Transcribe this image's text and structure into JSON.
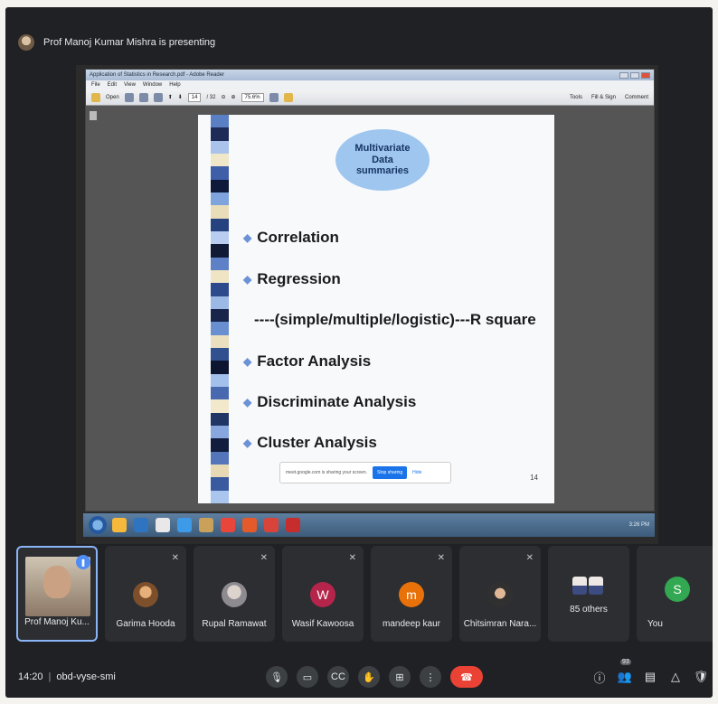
{
  "presenter_bar": {
    "text": "Prof Manoj Kumar Mishra is presenting"
  },
  "reader": {
    "title": "Application of Statistics in Research.pdf - Adobe Reader",
    "menu": [
      "File",
      "Edit",
      "View",
      "Window",
      "Help"
    ],
    "toolbar": {
      "open": "Open",
      "page": "14",
      "page_total": "/ 32",
      "zoom": "75.6%",
      "tools": "Tools",
      "fill_sign": "Fill & Sign",
      "comment": "Comment"
    }
  },
  "slide": {
    "oval_lines": [
      "Multivariate",
      "Data",
      "summaries"
    ],
    "bullets": [
      "Correlation",
      "Regression",
      "Factor Analysis",
      "Discriminate Analysis",
      "Cluster Analysis"
    ],
    "regression_sub": "----(simple/multiple/logistic)---R square",
    "page_number": "14",
    "stripe_colors": [
      "#5b7fc4",
      "#1d2b56",
      "#a9c3ea",
      "#f0e6c8",
      "#3e5fa8",
      "#0f1a3a",
      "#7fa3dc",
      "#e9dcb8",
      "#26427f",
      "#b8cdef",
      "#101a34",
      "#5d80c6",
      "#efe4c4",
      "#2c4a8c",
      "#9cb9e6",
      "#18244a",
      "#6a8fd0",
      "#eadfbe",
      "#30508f",
      "#0d1630",
      "#a3c0ec",
      "#4869b0",
      "#f2e8cc",
      "#203766",
      "#87a7de",
      "#121d3e",
      "#5575bb",
      "#e6d9b4",
      "#3a5aa0",
      "#aac5ee"
    ]
  },
  "share_banner": {
    "text": "meet.google.com is sharing your screen.",
    "stop": "Stop sharing",
    "hide": "Hide"
  },
  "taskbar": {
    "icons": [
      "#f6b93b",
      "#2f74c0",
      "#e8e8e8",
      "#3d9ae8",
      "#c9a15a",
      "#e8463a",
      "#e55a2a",
      "#d9443a",
      "#c62d2d"
    ],
    "clock": "3:26 PM"
  },
  "participants": [
    {
      "name": "Prof Manoj Ku..."
    },
    {
      "name": "Garima Hooda"
    },
    {
      "name": "Rupal Ramawat"
    },
    {
      "name": "Wasif Kawoosa",
      "initial": "W",
      "color": "#b5254b"
    },
    {
      "name": "mandeep kaur",
      "initial": "m",
      "color": "#e8710a"
    },
    {
      "name": "Chitsimran Nara..."
    },
    {
      "name": "85 others"
    },
    {
      "name": "You",
      "initial": "S",
      "color": "#33a852"
    }
  ],
  "bottom_bar": {
    "time": "14:20",
    "meeting_code": "obd-vyse-smi",
    "people_count": "93"
  }
}
